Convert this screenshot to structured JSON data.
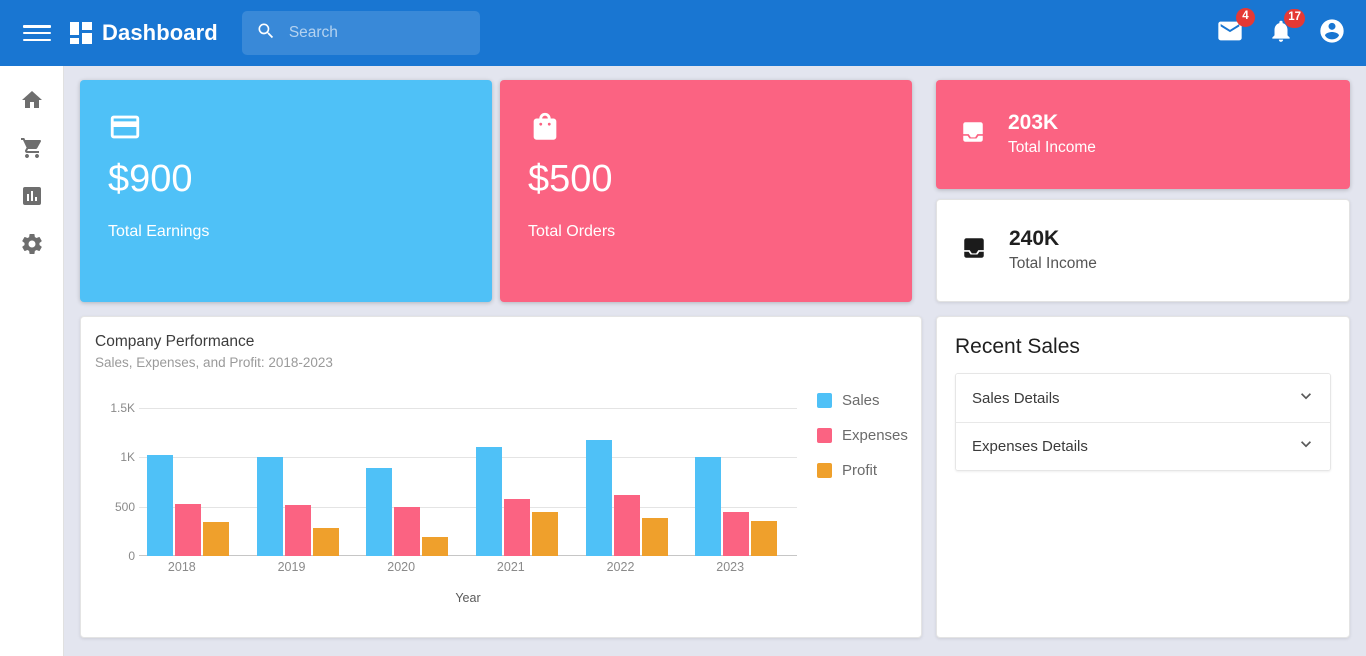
{
  "topbar": {
    "menu_icon": "hamburger-menu-icon",
    "logo_icon": "dashboard-grid-icon",
    "title": "Dashboard",
    "search": {
      "icon": "search-icon",
      "value": "",
      "placeholder": "Search"
    },
    "mail": {
      "icon": "mail-icon",
      "badge": "4"
    },
    "notifications": {
      "icon": "bell-icon",
      "badge": "17"
    },
    "account": {
      "icon": "account-circle-icon"
    }
  },
  "sidebar": {
    "items": [
      {
        "icon": "home-icon",
        "name": "home"
      },
      {
        "icon": "shopping-cart-icon",
        "name": "orders"
      },
      {
        "icon": "bar-chart-icon",
        "name": "analytics"
      },
      {
        "icon": "gear-icon",
        "name": "settings"
      }
    ]
  },
  "stat_cards": [
    {
      "icon": "credit-card-icon",
      "amount": "$900",
      "caption": "Total Earnings",
      "color": "#4fc1f7"
    },
    {
      "icon": "shopping-bag-icon",
      "amount": "$500",
      "caption": "Total Orders",
      "color": "#fb6382"
    }
  ],
  "income_cards": [
    {
      "icon": "inbox-tray-icon",
      "value": "203K",
      "label": "Total Income",
      "color": "#fb6382"
    },
    {
      "icon": "inbox-tray-icon",
      "value": "240K",
      "label": "Total Income",
      "color": "#ffffff"
    }
  ],
  "chart_data": {
    "type": "bar",
    "title": "Company Performance",
    "subtitle": "Sales, Expenses, and Profit: 2018-2023",
    "categories": [
      "2018",
      "2019",
      "2020",
      "2021",
      "2022",
      "2023"
    ],
    "series": [
      {
        "name": "Sales",
        "color": "#4fc1f7",
        "values": [
          1020,
          1000,
          890,
          1100,
          1180,
          1000
        ]
      },
      {
        "name": "Expenses",
        "color": "#fb6382",
        "values": [
          530,
          515,
          495,
          580,
          620,
          450
        ]
      },
      {
        "name": "Profit",
        "color": "#efa02c",
        "values": [
          340,
          280,
          190,
          450,
          390,
          350
        ]
      }
    ],
    "xlabel": "Year",
    "ylabel": "",
    "ylim": [
      0,
      1500
    ],
    "yticks": [
      0,
      500,
      1000,
      1500
    ],
    "ytick_labels": [
      "0",
      "500",
      "1K",
      "1.5K"
    ],
    "grid": true,
    "legend_position": "right"
  },
  "recent_sales": {
    "title": "Recent Sales",
    "items": [
      {
        "label": "Sales Details",
        "icon": "chevron-down-icon"
      },
      {
        "label": "Expenses Details",
        "icon": "chevron-down-icon"
      }
    ]
  }
}
